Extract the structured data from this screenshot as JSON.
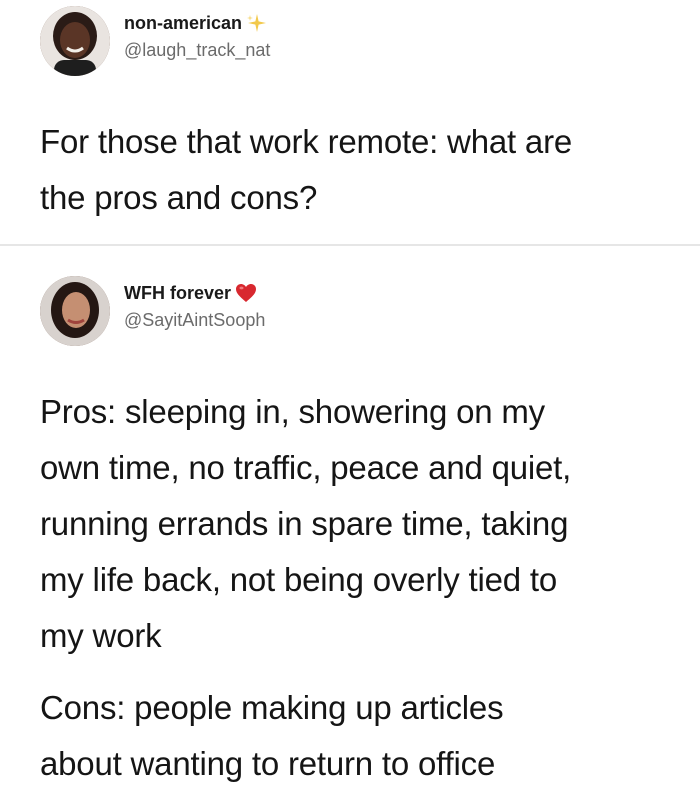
{
  "tweets": [
    {
      "display_name": "non-american",
      "handle": "@laugh_track_nat",
      "badge_icon": "sparkle-icon",
      "text_lines": [
        "For those that work remote: what are",
        "the pros and cons?"
      ]
    },
    {
      "display_name": "WFH forever",
      "handle": "@SayitAintSooph",
      "badge_icon": "heart-icon",
      "pros_lines": [
        "Pros: sleeping in, showering on my",
        "own time, no traffic, peace and quiet,",
        "running errands in spare time, taking",
        "my life back, not being overly tied to",
        "my work"
      ],
      "cons_lines": [
        "Cons: people making up articles",
        "about wanting to return to office"
      ]
    }
  ],
  "colors": {
    "name": "#1a1a1a",
    "handle": "#6b6b6b",
    "text": "#151515",
    "divider": "#e6e6e6",
    "heart": "#d8282f",
    "sparkle": "#f2c94c"
  }
}
